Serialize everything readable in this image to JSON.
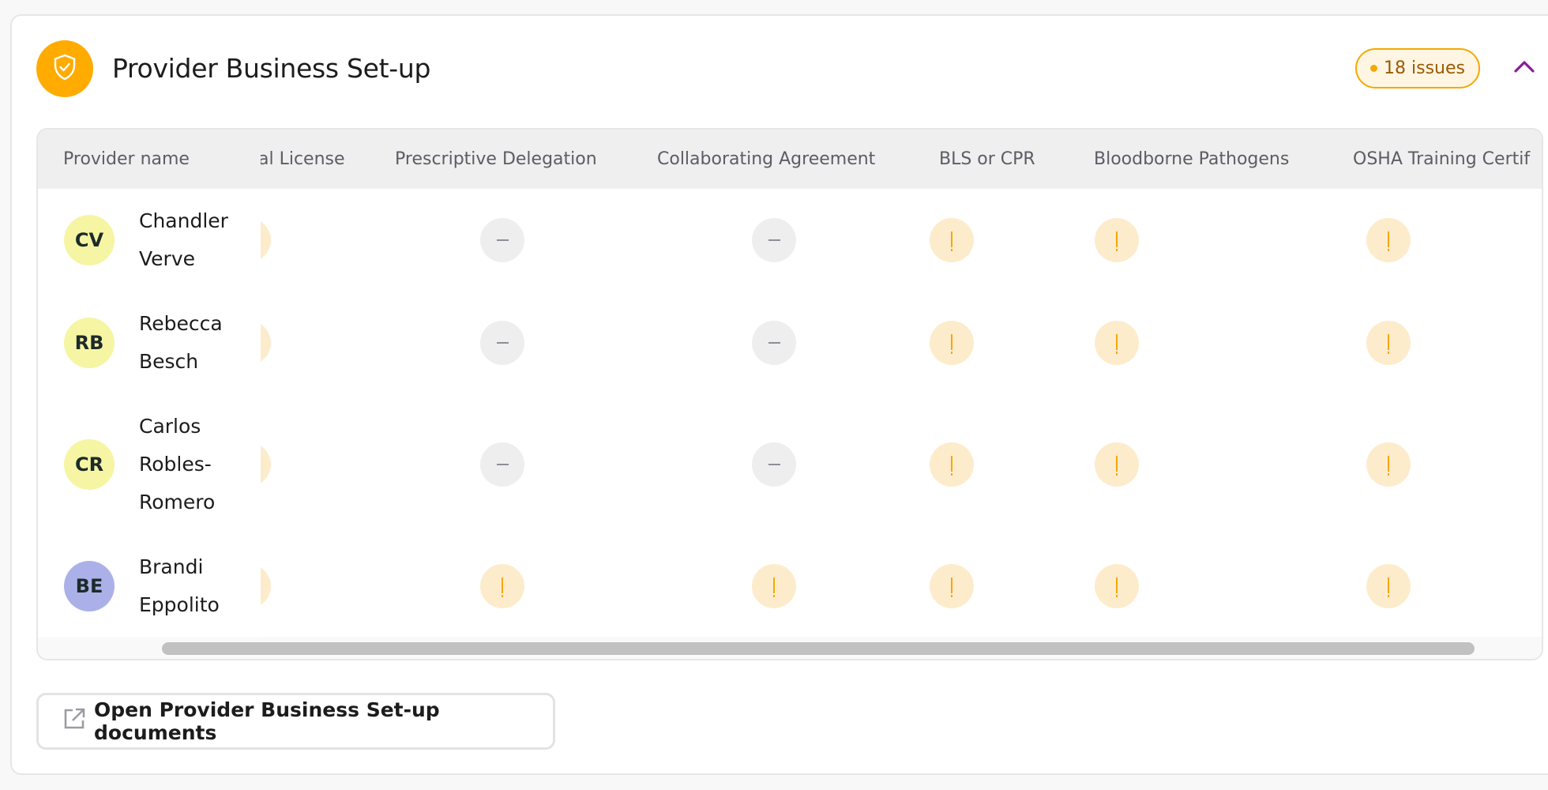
{
  "section": {
    "title": "Provider Business Set-up",
    "icon": "shield-check-icon",
    "issues_badge": "18 issues",
    "collapse_icon": "chevron-up-icon",
    "colors": {
      "accent_orange": "#ffab00",
      "badge_border": "#f5a800",
      "badge_text": "#9a5b00",
      "chevron": "#8b1a9a",
      "warn_bg": "#fdeccc",
      "na_bg": "#eeeeee"
    }
  },
  "table": {
    "columns": [
      "Provider name",
      "al License",
      "Prescriptive Delegation",
      "Collaborating Agreement",
      "BLS or CPR",
      "Bloodborne Pathogens",
      "OSHA Training Certif"
    ],
    "rows": [
      {
        "initials": "CV",
        "name": "Chandler Verve",
        "avatar_color": "#f6f5a3",
        "statuses": [
          "warning",
          "not-applicable",
          "not-applicable",
          "warning",
          "warning",
          "warning"
        ]
      },
      {
        "initials": "RB",
        "name": "Rebecca Besch",
        "avatar_color": "#f6f5a3",
        "statuses": [
          "warning",
          "not-applicable",
          "not-applicable",
          "warning",
          "warning",
          "warning"
        ]
      },
      {
        "initials": "CR",
        "name": "Carlos Robles-Romero",
        "avatar_color": "#f6f5a3",
        "statuses": [
          "warning",
          "not-applicable",
          "not-applicable",
          "warning",
          "warning",
          "warning"
        ]
      },
      {
        "initials": "BE",
        "name": "Brandi Eppolito",
        "avatar_color": "#abb1e8",
        "statuses": [
          "warning",
          "warning",
          "warning",
          "warning",
          "warning",
          "warning"
        ]
      }
    ]
  },
  "footer": {
    "open_documents_label": "Open Provider Business Set-up documents",
    "open_documents_icon": "external-link-icon"
  }
}
